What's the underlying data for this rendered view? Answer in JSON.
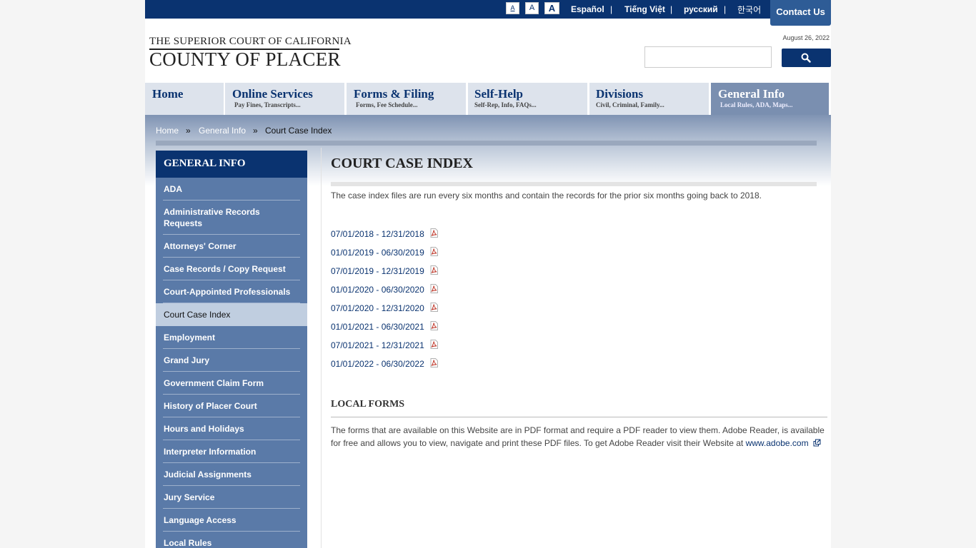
{
  "topbar": {
    "font_sizes": [
      "A",
      "A",
      "A"
    ],
    "languages": [
      "Español",
      "Tiếng Việt",
      "русский",
      "한국어"
    ],
    "separator": "|",
    "contact_label": "Contact Us"
  },
  "header": {
    "logo_line1": "THE SUPERIOR COURT OF CALIFORNIA",
    "logo_line2": "COUNTY OF PLACER",
    "date": "August 26, 2022",
    "search_placeholder": "",
    "search_icon": "search-icon"
  },
  "nav": [
    {
      "title": "Home",
      "sub": ""
    },
    {
      "title": "Online Services",
      "sub": "Pay Fines, Transcripts..."
    },
    {
      "title": "Forms & Filing",
      "sub": "Forms, Fee Schedule..."
    },
    {
      "title": "Self-Help",
      "sub": "Self-Rep, Info, FAQs..."
    },
    {
      "title": "Divisions",
      "sub": "Civil, Criminal, Family..."
    },
    {
      "title": "General Info",
      "sub": "Local Rules, ADA, Maps..."
    }
  ],
  "breadcrumb": {
    "items": [
      "Home",
      "General Info",
      "Court Case Index"
    ],
    "separator": "»"
  },
  "sidebar": {
    "title": "GENERAL INFO",
    "items": [
      "ADA",
      "Administrative Records Requests",
      "Attorneys' Corner",
      "Case Records / Copy Request",
      "Court-Appointed Professionals",
      "Court Case Index",
      "Employment",
      "Grand Jury",
      "Government Claim Form",
      "History of Placer Court",
      "Hours and Holidays",
      "Interpreter Information",
      "Judicial Assignments",
      "Jury Service",
      "Language Access",
      "Local Rules"
    ],
    "active": "Court Case Index"
  },
  "main": {
    "title": "COURT CASE INDEX",
    "intro": "The case index files are run every six months and contain the records for the prior six months going back to 2018.",
    "files": [
      "07/01/2018 - 12/31/2018",
      "01/01/2019 - 06/30/2019",
      "07/01/2019 - 12/31/2019",
      "01/01/2020 - 06/30/2020",
      "07/01/2020 - 12/31/2020",
      "01/01/2021 - 06/30/2021",
      "07/01/2021 - 12/31/2021",
      "01/01/2022 - 06/30/2022"
    ],
    "file_icon": "pdf-icon",
    "local_forms_title": "LOCAL FORMS",
    "local_forms_text": "The forms that are available on this Website are in PDF format and require a PDF reader to view them. Adobe Reader, is available for free and allows you to view, navigate and print these PDF files. To get Adobe Reader visit their Website at",
    "local_forms_link": "www.adobe.com",
    "external_icon": "external-link-icon"
  },
  "colors": {
    "brand_navy": "#0a3370",
    "sidebar_blue": "#5a7aa8",
    "nav_bg": "#dde3ec",
    "nav_active": "#7a8fb0"
  }
}
